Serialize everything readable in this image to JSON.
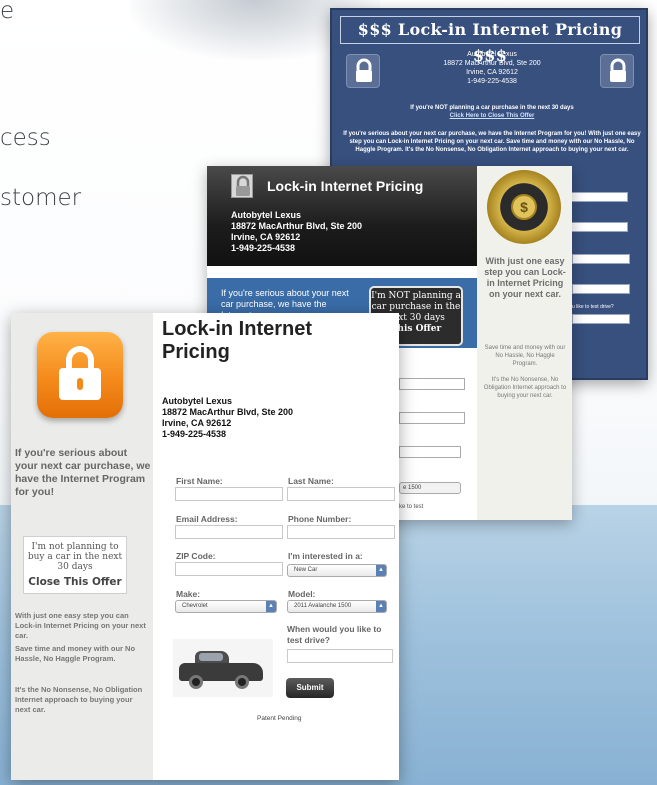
{
  "colors": {
    "headline_text": "#3a3f44",
    "lock_orange": "#f48a1a",
    "card_blue_back": "#38507e",
    "card_blue_mid": "#3a6ca7",
    "bottom_band": "#9fc2dd"
  },
  "background_text": {
    "line1": "e",
    "line2": "cess",
    "line3": "stomer"
  },
  "card_back": {
    "title": "$$$ Lock-in Internet Pricing $$$",
    "dealer_name": "Autobytel Lexus",
    "dealer_street": "18872 MacArthur Blvd, Ste 200",
    "dealer_city": "Irvine, CA 92612",
    "dealer_phone": "1-949-225-4538",
    "not_planning": "If you're NOT planning a car purchase in the next 30 days",
    "close_offer": "Click Here to Close This Offer",
    "body": "If you're serious about your next car purchase, we have the Internet Program for you! With just one easy step you can Lock-in Internet Pricing on your next car. Save time and money with our No Hassle, No Haggle Program. It's the No Nonsense, No Obligation Internet approach to buying your next car.",
    "lock_icon": "lock-icon"
  },
  "card_middle": {
    "title": "Lock-in Internet Pricing",
    "dealer_name": "Autobytel Lexus",
    "dealer_street": "18872 MacArthur Blvd, Ste 200",
    "dealer_city": "Irvine, CA 92612",
    "dealer_phone": "1-949-225-4538",
    "serious_text": "If you're serious about your next car purchase, we have the Internet",
    "not_planning_text": "I'm NOT planning a car purchase in the next 30 days",
    "close_offer": "This Offer",
    "seal_symbol": "$",
    "just_one_step": "With just one easy step you can Lock-in Internet Pricing on your next car.",
    "save_time": "Save time and money with our No Hassle, No Haggle Program.",
    "no_nonsense": "It's the No Nonsense, No Obligation Internet approach to buying your next car.",
    "model_value": "e 1500",
    "test_drive_fragment": "ke to test",
    "test_drive_fragment_back": "u like to test drive?"
  },
  "card_front": {
    "lock_icon": "lock-icon",
    "serious_text": "If you're serious about your next car purchase, we have the Internet Program for you!",
    "not_planning_text": "I'm not planning to buy a car in the next 30 days",
    "close_offer": "Close This Offer",
    "just_one_step": "With just one easy step you can Lock-in Internet Pricing on your next car.",
    "save_time": "Save time and money with our No Hassle, No Haggle Program.",
    "no_nonsense": "It's the No Nonsense, No Obligation Internet approach to buying your next car.",
    "title": "Lock-in Internet Pricing",
    "dealer_name": "Autobytel Lexus",
    "dealer_street": "18872 MacArthur Blvd, Ste 200",
    "dealer_city": "Irvine, CA 92612",
    "dealer_phone": "1-949-225-4538",
    "form": {
      "first_name_label": "First Name:",
      "last_name_label": "Last Name:",
      "email_label": "Email Address:",
      "phone_label": "Phone Number:",
      "zip_label": "ZIP Code:",
      "interested_label": "I'm interested in a:",
      "interested_value": "New Car",
      "make_label": "Make:",
      "make_value": "Chevrolet",
      "model_label": "Model:",
      "model_value": "2011 Avalanche 1500",
      "test_drive_label": "When would you like to test drive?",
      "submit_label": "Submit"
    },
    "patent": "Patent Pending"
  }
}
